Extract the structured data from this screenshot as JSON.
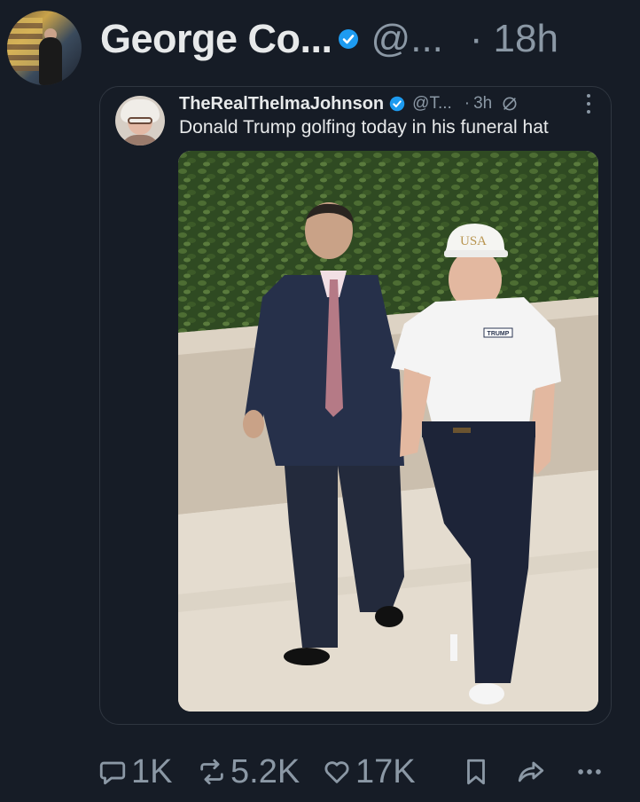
{
  "post": {
    "author": {
      "display_name": "George Co...",
      "handle": "@...",
      "verified": true
    },
    "separator": "·",
    "time": "18h"
  },
  "quoted_post": {
    "author": {
      "display_name": "TheRealThelmaJohnson",
      "handle": "@T...",
      "verified": true
    },
    "separator": "·",
    "time": "3h",
    "text": "Donald Trump golfing today in his funeral hat",
    "image": {
      "hat_text": "USA",
      "shirt_logo_text": "TRUMP"
    }
  },
  "actions": {
    "replies": "1K",
    "reposts": "5.2K",
    "likes": "17K",
    "bookmark_icon": "bookmark-icon",
    "share_icon": "share-icon",
    "more_icon": "more-icon"
  },
  "colors": {
    "background": "#161c26",
    "text_primary": "#e7e9ea",
    "text_secondary": "#8b98a5",
    "verified": "#1d9bf0",
    "card_border": "#2f3640"
  }
}
